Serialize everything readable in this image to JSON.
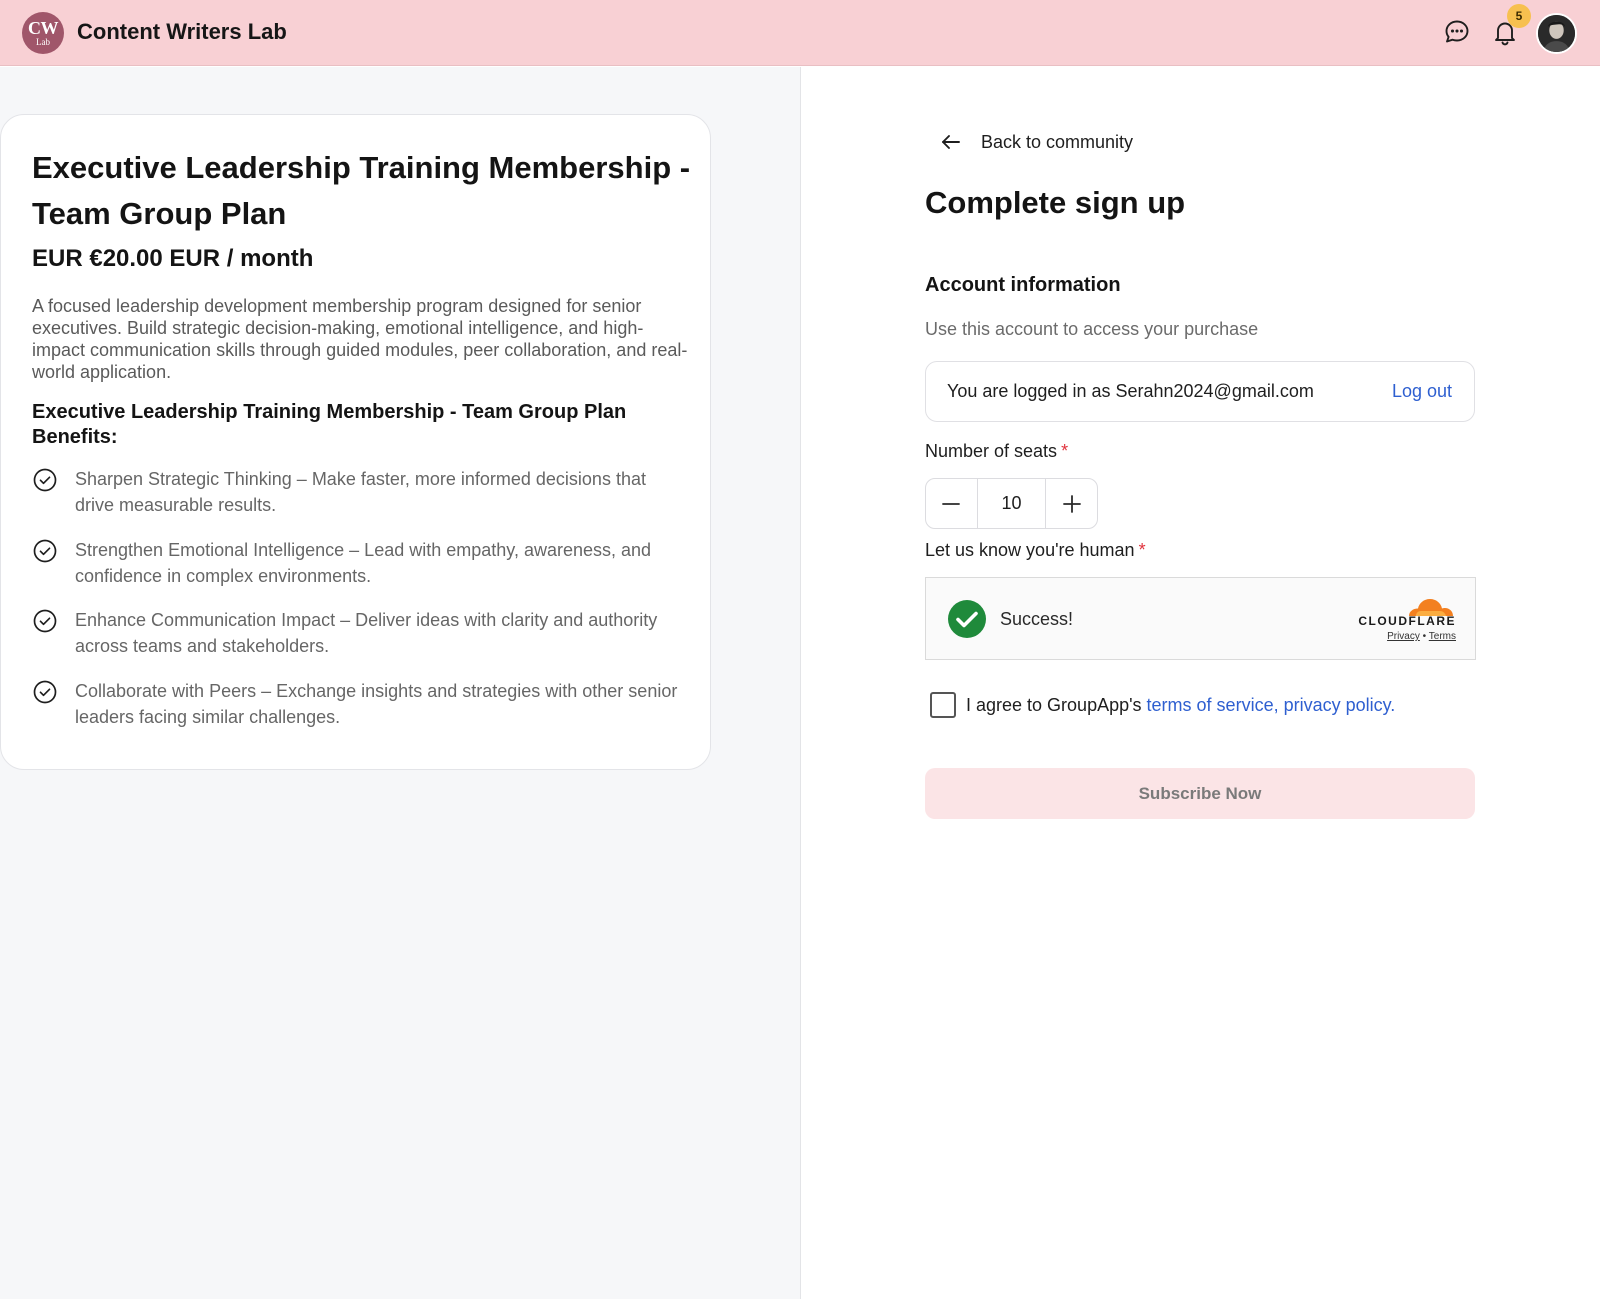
{
  "header": {
    "logo_line1": "CW",
    "logo_line2": "Lab",
    "app_title": "Content Writers Lab",
    "notification_count": "5",
    "icons": [
      "chat-bubble-icon",
      "bell-icon",
      "avatar"
    ]
  },
  "plan": {
    "title": "Executive Leadership Training Membership - Team Group Plan",
    "price": "EUR €20.00 EUR / month",
    "description": "A focused leadership development membership program designed for senior executives. Build strategic decision-making, emotional intelligence, and high-impact communication skills through guided modules, peer collaboration, and real-world application.",
    "benefits_title": "Executive Leadership Training Membership - Team Group Plan Benefits:",
    "benefits": [
      "Sharpen Strategic Thinking – Make faster, more informed decisions that drive measurable results.",
      "Strengthen Emotional Intelligence – Lead with empathy, awareness, and confidence in complex environments.",
      "Enhance Communication Impact – Deliver ideas with clarity and authority across teams and stakeholders.",
      "Collaborate with Peers – Exchange insights and strategies with other senior leaders facing similar challenges."
    ]
  },
  "signup": {
    "back_label": "Back to community",
    "page_title": "Complete sign up",
    "section_title": "Account information",
    "section_subtitle": "Use this account to access your purchase",
    "logged_in_text": "You are logged in as Serahn2024@gmail.com",
    "logout_label": "Log out",
    "seats_label": "Number of seats",
    "required_mark": "*",
    "seats_value": "10",
    "human_label": "Let us know you're human",
    "captcha_status": "Success!",
    "captcha_brand": "CLOUDFLARE",
    "captcha_privacy": "Privacy",
    "captcha_sep": "•",
    "captcha_terms": "Terms",
    "agree_text": "I agree to GroupApp's",
    "agree_link": "terms of service, privacy policy.",
    "agree_checked": false,
    "subscribe_label": "Subscribe Now"
  },
  "colors": {
    "header_bg": "#f8d0d4",
    "logo_bg": "#a0566a",
    "badge_bg": "#f7c04f",
    "link": "#2e5fd0",
    "required": "#e0323c",
    "success_green": "#1f8a3b",
    "cloudflare_orange": "#f38020",
    "subscribe_bg": "#fbe4e6"
  }
}
